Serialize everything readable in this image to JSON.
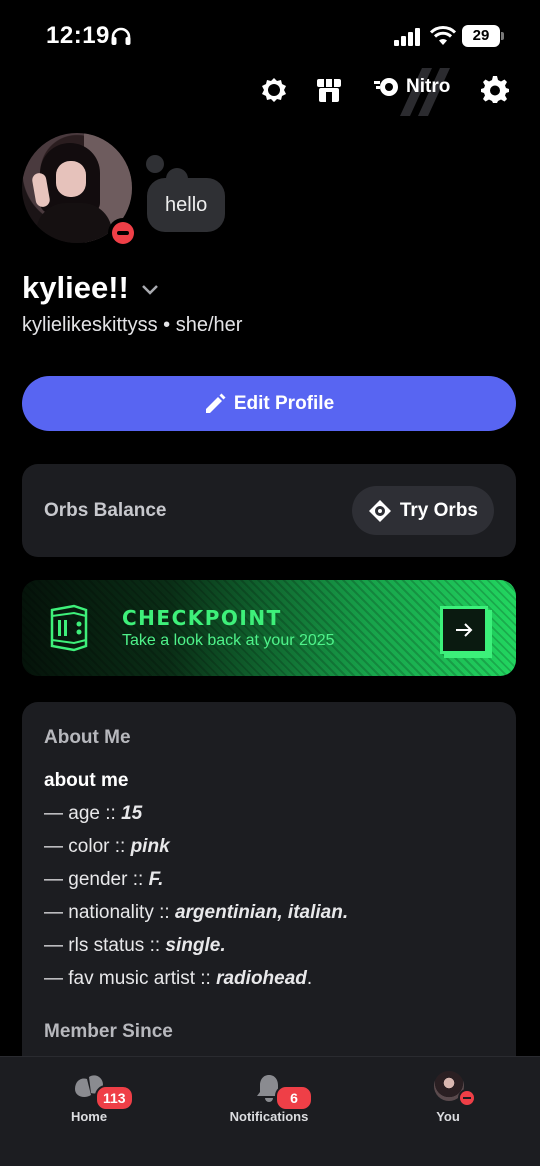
{
  "status_bar": {
    "time": "12:19",
    "battery": "29"
  },
  "header": {
    "nitro_label": "Nitro"
  },
  "profile": {
    "status_text": "hello",
    "display_name": "kyliee!!",
    "username": "kylielikeskittyss",
    "separator": "•",
    "pronouns": "she/her"
  },
  "edit_profile_label": "Edit Profile",
  "orbs": {
    "label": "Orbs Balance",
    "button_label": "Try Orbs"
  },
  "checkpoint": {
    "title": "CHECKPOINT",
    "subtitle": "Take a look back at your 2025"
  },
  "about": {
    "title": "About Me",
    "heading": "about me",
    "lines": [
      {
        "prefix": "— age :: ",
        "value": "15",
        "suffix": ""
      },
      {
        "prefix": "— color :: ",
        "value": "pink",
        "suffix": ""
      },
      {
        "prefix": "— gender :: ",
        "value": "F.",
        "suffix": ""
      },
      {
        "prefix": "— nationality :: ",
        "value": "argentinian, italian.",
        "suffix": ""
      },
      {
        "prefix": "— rls status :: ",
        "value": "single.",
        "suffix": ""
      },
      {
        "prefix": "— fav music artist :: ",
        "value": "radiohead",
        "suffix": "."
      }
    ],
    "member_since_label": "Member Since"
  },
  "nav": {
    "home_label": "Home",
    "home_badge": "113",
    "notifications_label": "Notifications",
    "notifications_badge": "6",
    "you_label": "You"
  },
  "colors": {
    "accent": "#5865f2",
    "dnd": "#ef3f47",
    "checkpoint_green": "#3ef07a"
  }
}
